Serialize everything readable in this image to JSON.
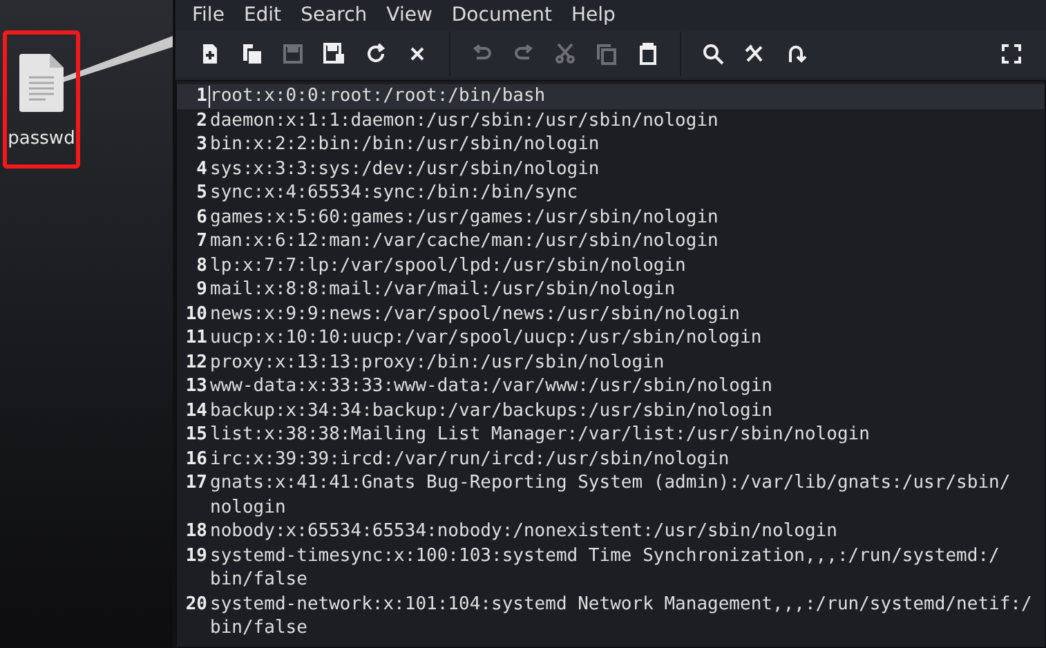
{
  "desktop": {
    "file_icon": {
      "label": "passwd",
      "highlighted": true
    }
  },
  "menu": [
    "File",
    "Edit",
    "Search",
    "View",
    "Document",
    "Help"
  ],
  "toolbar": [
    {
      "kind": "new",
      "disabled": false
    },
    {
      "kind": "new-window",
      "disabled": false
    },
    {
      "kind": "save",
      "disabled": true
    },
    {
      "kind": "save-as",
      "disabled": false
    },
    {
      "kind": "reload",
      "disabled": false
    },
    {
      "kind": "close",
      "disabled": false
    },
    {
      "kind": "separator"
    },
    {
      "kind": "undo",
      "disabled": true
    },
    {
      "kind": "redo",
      "disabled": true
    },
    {
      "kind": "cut",
      "disabled": true
    },
    {
      "kind": "copy",
      "disabled": true
    },
    {
      "kind": "paste",
      "disabled": false
    },
    {
      "kind": "separator"
    },
    {
      "kind": "find",
      "disabled": false
    },
    {
      "kind": "replace",
      "disabled": false
    },
    {
      "kind": "goto",
      "disabled": false
    },
    {
      "kind": "spacer"
    },
    {
      "kind": "fullscreen",
      "disabled": false
    }
  ],
  "editor": {
    "lines": [
      {
        "number": "1",
        "current": true,
        "rows": [
          "root:x:0:0:root:/root:/bin/bash"
        ]
      },
      {
        "number": "2",
        "current": false,
        "rows": [
          "daemon:x:1:1:daemon:/usr/sbin:/usr/sbin/nologin"
        ]
      },
      {
        "number": "3",
        "current": false,
        "rows": [
          "bin:x:2:2:bin:/bin:/usr/sbin/nologin"
        ]
      },
      {
        "number": "4",
        "current": false,
        "rows": [
          "sys:x:3:3:sys:/dev:/usr/sbin/nologin"
        ]
      },
      {
        "number": "5",
        "current": false,
        "rows": [
          "sync:x:4:65534:sync:/bin:/bin/sync"
        ]
      },
      {
        "number": "6",
        "current": false,
        "rows": [
          "games:x:5:60:games:/usr/games:/usr/sbin/nologin"
        ]
      },
      {
        "number": "7",
        "current": false,
        "rows": [
          "man:x:6:12:man:/var/cache/man:/usr/sbin/nologin"
        ]
      },
      {
        "number": "8",
        "current": false,
        "rows": [
          "lp:x:7:7:lp:/var/spool/lpd:/usr/sbin/nologin"
        ]
      },
      {
        "number": "9",
        "current": false,
        "rows": [
          "mail:x:8:8:mail:/var/mail:/usr/sbin/nologin"
        ]
      },
      {
        "number": "10",
        "current": false,
        "rows": [
          "news:x:9:9:news:/var/spool/news:/usr/sbin/nologin"
        ]
      },
      {
        "number": "11",
        "current": false,
        "rows": [
          "uucp:x:10:10:uucp:/var/spool/uucp:/usr/sbin/nologin"
        ]
      },
      {
        "number": "12",
        "current": false,
        "rows": [
          "proxy:x:13:13:proxy:/bin:/usr/sbin/nologin"
        ]
      },
      {
        "number": "13",
        "current": false,
        "rows": [
          "www-data:x:33:33:www-data:/var/www:/usr/sbin/nologin"
        ]
      },
      {
        "number": "14",
        "current": false,
        "rows": [
          "backup:x:34:34:backup:/var/backups:/usr/sbin/nologin"
        ]
      },
      {
        "number": "15",
        "current": false,
        "rows": [
          "list:x:38:38:Mailing List Manager:/var/list:/usr/sbin/nologin"
        ]
      },
      {
        "number": "16",
        "current": false,
        "rows": [
          "irc:x:39:39:ircd:/var/run/ircd:/usr/sbin/nologin"
        ]
      },
      {
        "number": "17",
        "current": false,
        "rows": [
          "gnats:x:41:41:Gnats Bug-Reporting System (admin):/var/lib/gnats:/usr/sbin/",
          "nologin"
        ]
      },
      {
        "number": "18",
        "current": false,
        "rows": [
          "nobody:x:65534:65534:nobody:/nonexistent:/usr/sbin/nologin"
        ]
      },
      {
        "number": "19",
        "current": false,
        "rows": [
          "systemd-timesync:x:100:103:systemd Time Synchronization,,,:/run/systemd:/",
          "bin/false"
        ]
      },
      {
        "number": "20",
        "current": false,
        "rows": [
          "systemd-network:x:101:104:systemd Network Management,,,:/run/systemd/netif:/",
          "bin/false"
        ]
      }
    ]
  }
}
